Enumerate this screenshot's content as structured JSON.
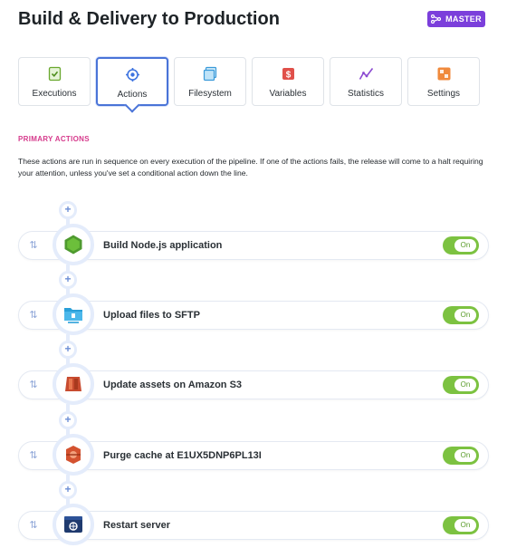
{
  "page": {
    "title": "Build & Delivery to Production"
  },
  "branch_badge": {
    "label": "MASTER",
    "color": "#7b3fdb",
    "icon": "branch-icon"
  },
  "tabs": [
    {
      "label": "Executions",
      "icon": "executions-icon",
      "active": false
    },
    {
      "label": "Actions",
      "icon": "actions-icon",
      "active": true
    },
    {
      "label": "Filesystem",
      "icon": "filesystem-icon",
      "active": false
    },
    {
      "label": "Variables",
      "icon": "variables-icon",
      "active": false
    },
    {
      "label": "Statistics",
      "icon": "statistics-icon",
      "active": false
    },
    {
      "label": "Settings",
      "icon": "settings-icon",
      "active": false
    }
  ],
  "primary_actions": {
    "heading": "PRIMARY ACTIONS",
    "description": "These actions are run in sequence on every execution of the pipeline. If one of the actions fails, the release will come to a halt requiring your attention, unless you've set a conditional action down the line.",
    "add_label": "+",
    "actions": [
      {
        "name": "Build Node.js application",
        "icon": "nodejs-icon",
        "toggle": "On"
      },
      {
        "name": "Upload files to SFTP",
        "icon": "sftp-icon",
        "toggle": "On"
      },
      {
        "name": "Update assets on Amazon S3",
        "icon": "amazon-s3-icon",
        "toggle": "On"
      },
      {
        "name": "Purge cache at E1UX5DNP6PL13I",
        "icon": "cloudfront-icon",
        "toggle": "On"
      },
      {
        "name": "Restart server",
        "icon": "server-icon",
        "toggle": "On"
      }
    ]
  },
  "colors": {
    "accent": "#4a74d8",
    "section_label": "#d63a8c",
    "toggle_on": "#7cc241",
    "badge": "#7b3fdb"
  }
}
